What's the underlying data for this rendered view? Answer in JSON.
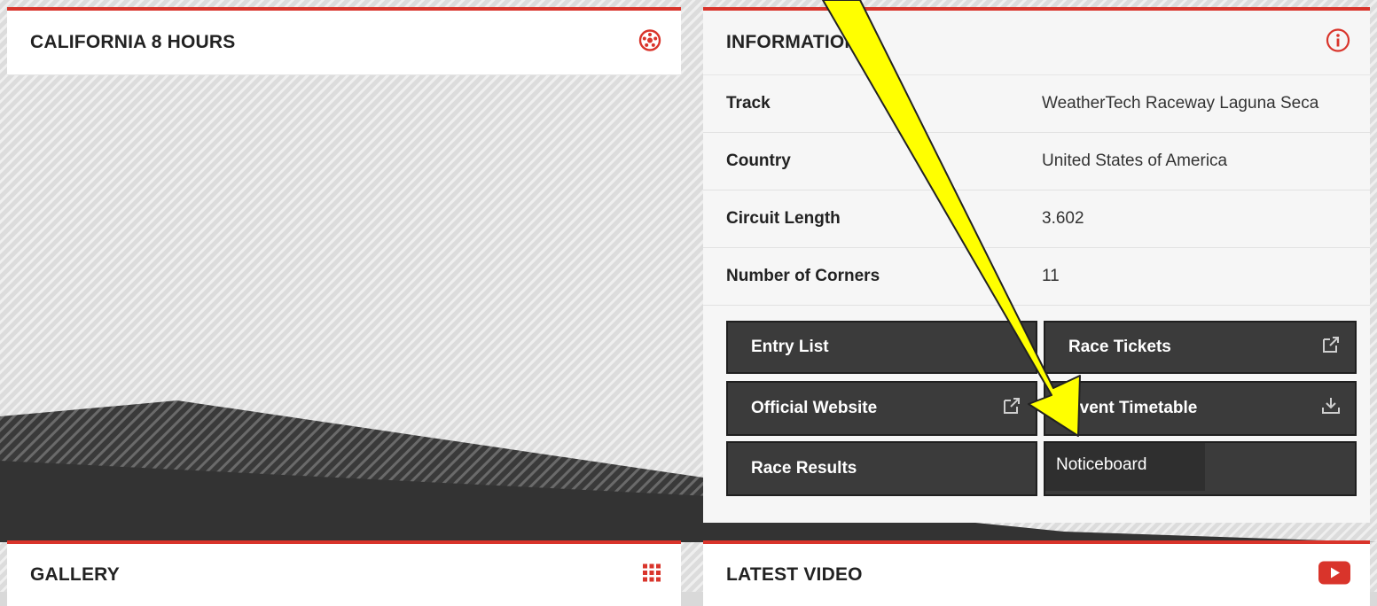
{
  "event_panel": {
    "title": "CALIFORNIA 8 HOURS",
    "icon": "tire-icon"
  },
  "info_panel": {
    "title": "INFORMATION",
    "icon": "info-icon",
    "rows": [
      {
        "label": "Track",
        "value": "WeatherTech Raceway Laguna Seca"
      },
      {
        "label": "Country",
        "value": "United States of America"
      },
      {
        "label": "Circuit Length",
        "value": "3.602"
      },
      {
        "label": "Number of Corners",
        "value": "11"
      }
    ],
    "buttons": {
      "entry_list": "Entry List",
      "race_tickets": "Race Tickets",
      "official_website": "Official Website",
      "event_timetable": "Event Timetable",
      "race_results": "Race Results",
      "noticeboard": "Noticeboard"
    }
  },
  "gallery_panel": {
    "title": "GALLERY",
    "icon": "grid-icon"
  },
  "video_panel": {
    "title": "LATEST VIDEO",
    "icon": "youtube-icon"
  },
  "colors": {
    "accent": "#d9342b",
    "button_bg": "#3b3b3b",
    "annotation_arrow": "#ffff00"
  }
}
